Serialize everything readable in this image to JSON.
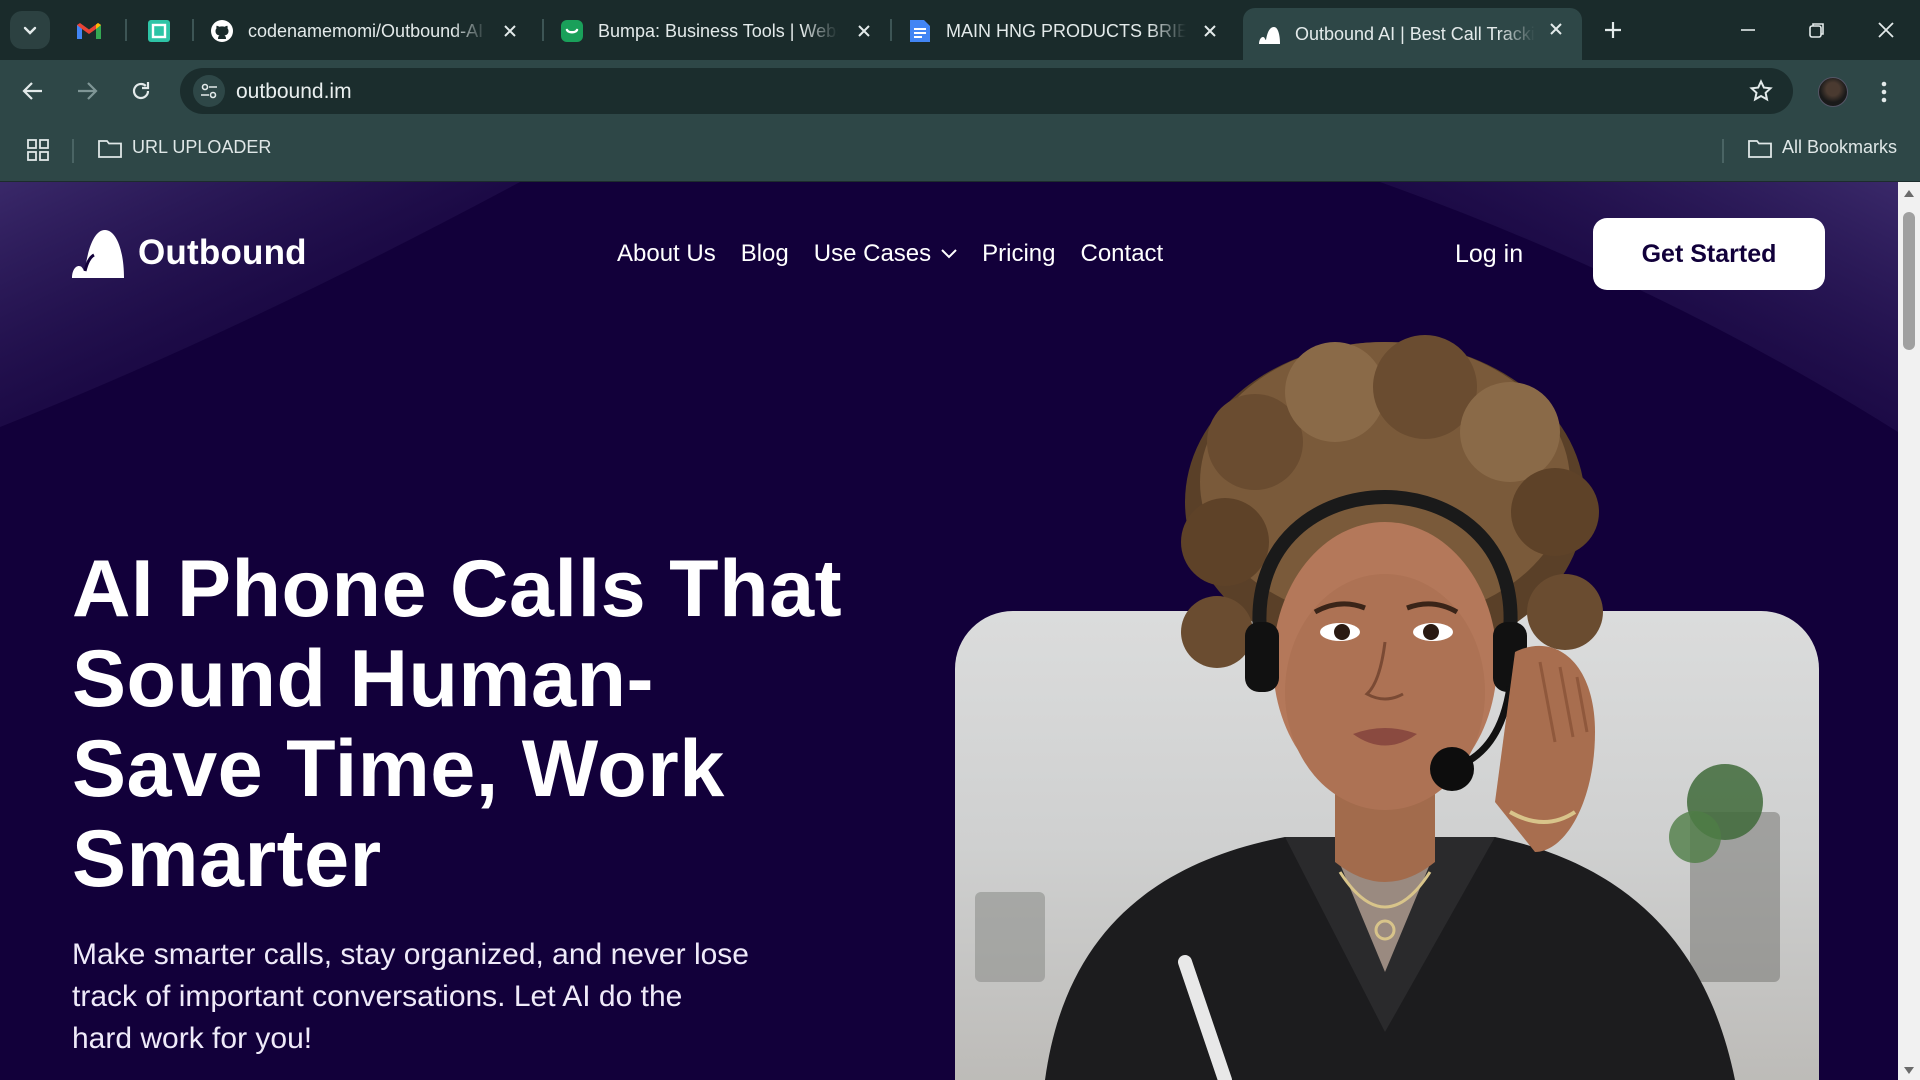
{
  "browser": {
    "tabs": [
      {
        "title": "codenamemomi/Outbound-AI",
        "icon": "github-icon"
      },
      {
        "title": "Bumpa: Business Tools | Website",
        "icon": "bumpa-icon"
      },
      {
        "title": "MAIN HNG PRODUCTS BRIEF",
        "icon": "docs-icon"
      },
      {
        "title": "Outbound AI | Best Call Tracking",
        "icon": "outbound-icon",
        "active": true
      }
    ],
    "pinned": [
      "gmail-icon",
      "app-icon"
    ],
    "url": "outbound.im",
    "bookmarks": {
      "folder": "URL UPLOADER",
      "all": "All Bookmarks"
    }
  },
  "site": {
    "brand": "Outbound",
    "nav": {
      "about": "About Us",
      "blog": "Blog",
      "use_cases": "Use Cases",
      "pricing": "Pricing",
      "contact": "Contact"
    },
    "login": "Log in",
    "cta": "Get Started",
    "hero": {
      "title_lines": [
        "AI Phone Calls That",
        "Sound Human-",
        "Save Time, Work",
        "Smarter"
      ],
      "subtitle_lines": [
        "Make smarter calls, stay organized, and never lose",
        "track of important conversations. Let AI do the",
        "hard work for you!"
      ]
    }
  },
  "colors": {
    "page_bg": "#12003a",
    "chrome_dark": "#1a2b2b",
    "chrome": "#2e4747",
    "cta_bg": "#ffffff",
    "cta_text": "#11003a"
  }
}
